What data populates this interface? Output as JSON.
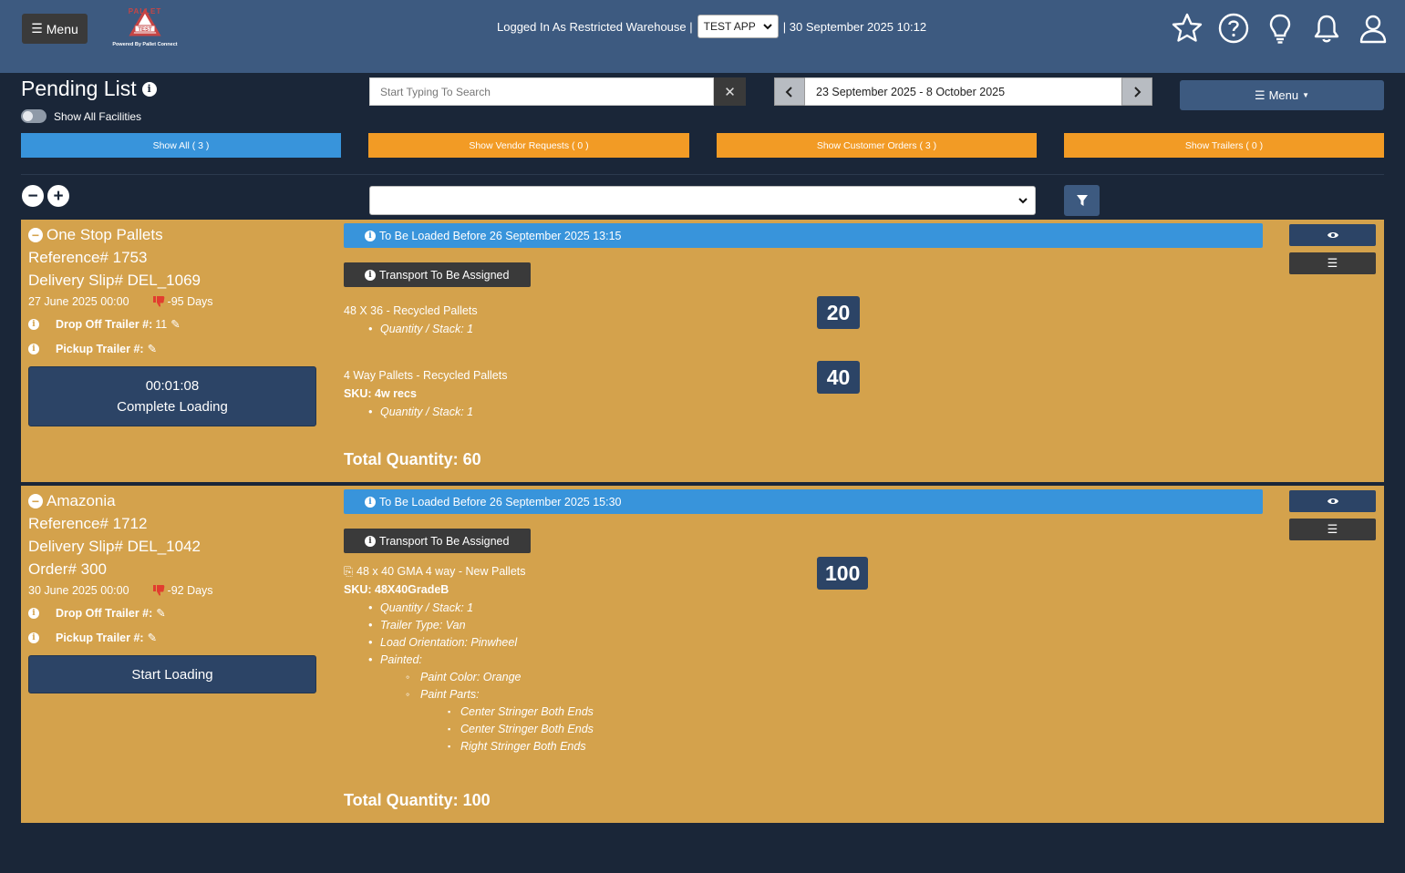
{
  "header": {
    "menu_label": "Menu",
    "logo_brand": "PALLET",
    "logo_badge": "TEST",
    "logo_powered": "Powered By Pallet Connect",
    "logged_in_text": "Logged In As Restricted Warehouse |",
    "app_selected": "TEST APP",
    "datetime_text": "| 30 September 2025 10:12"
  },
  "page": {
    "title": "Pending List",
    "show_all_facilities": "Show All Facilities",
    "search_placeholder": "Start Typing To Search",
    "clear_symbol": "✕",
    "date_range": "23 September 2025 - 8 October 2025",
    "menu_label": "Menu"
  },
  "tabs": {
    "all": "Show All ( 3 )",
    "vendor": "Show Vendor Requests ( 0 )",
    "customer": "Show Customer Orders ( 3 )",
    "trailers": "Show Trailers ( 0 )"
  },
  "colors": {
    "header_bg": "#3d5a80",
    "page_bg": "#1a2638",
    "card_bg": "#d4a24c",
    "tab_blue": "#3894db",
    "tab_orange": "#f29b25",
    "danger": "#e23d2f"
  },
  "orders": [
    {
      "company": "One Stop Pallets",
      "reference": "Reference# 1753",
      "delivery_slip": "Delivery Slip# DEL_1069",
      "date": "27 June 2025 00:00",
      "days": "-95 Days",
      "drop_off_label": "Drop Off Trailer #:",
      "drop_off_value": "11",
      "pickup_label": "Pickup Trailer #:",
      "timer": "00:01:08",
      "action": "Complete Loading",
      "deadline": "To Be Loaded Before 26 September 2025 13:15",
      "transport": "Transport To Be Assigned",
      "items": [
        {
          "title": "48 X 36 - Recycled Pallets",
          "qty_stack": "Quantity / Stack: 1",
          "quantity": "20"
        },
        {
          "title": "4 Way Pallets - Recycled Pallets",
          "sku": "SKU: 4w recs",
          "qty_stack": "Quantity / Stack: 1",
          "quantity": "40"
        }
      ],
      "total": "Total Quantity: 60"
    },
    {
      "company": "Amazonia",
      "reference": "Reference# 1712",
      "delivery_slip": "Delivery Slip# DEL_1042",
      "order": "Order# 300",
      "date": "30 June 2025 00:00",
      "days": "-92 Days",
      "drop_off_label": "Drop Off Trailer #:",
      "pickup_label": "Pickup Trailer #:",
      "action": "Start Loading",
      "deadline": "To Be Loaded Before 26 September 2025 15:30",
      "transport": "Transport To Be Assigned",
      "items": [
        {
          "title": "48 x 40 GMA 4 way - New Pallets",
          "sku": "SKU: 48X40GradeB",
          "qty_stack": "Quantity / Stack: 1",
          "trailer_type": "Trailer Type: Van",
          "load_orientation": "Load Orientation: Pinwheel",
          "painted": "Painted:",
          "paint_color": "Paint Color: Orange",
          "paint_parts": "Paint Parts:",
          "parts": [
            "Center Stringer Both Ends",
            "Center Stringer Both Ends",
            "Right Stringer Both Ends"
          ],
          "quantity": "100"
        }
      ],
      "total": "Total Quantity: 100"
    }
  ]
}
